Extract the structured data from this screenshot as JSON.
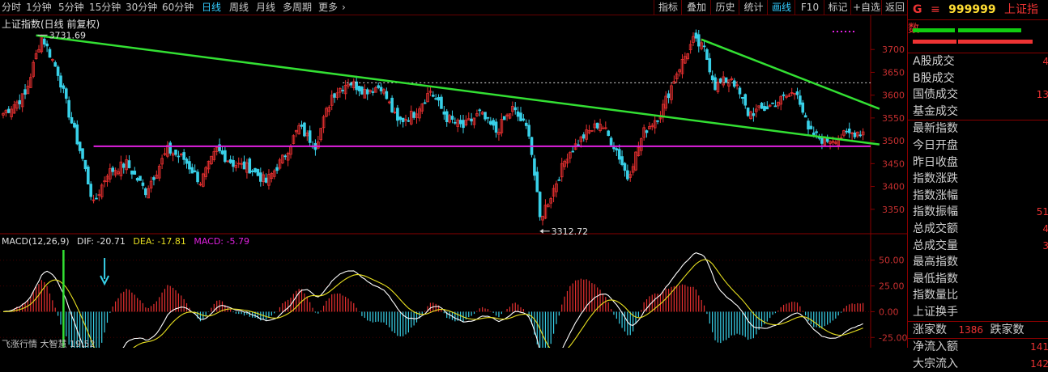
{
  "timeframes": [
    {
      "label": "分时",
      "active": false
    },
    {
      "label": "1分钟",
      "active": false
    },
    {
      "label": "5分钟",
      "active": false
    },
    {
      "label": "15分钟",
      "active": false
    },
    {
      "label": "30分钟",
      "active": false
    },
    {
      "label": "60分钟",
      "active": false
    },
    {
      "label": "日线",
      "active": true
    },
    {
      "label": "周线",
      "active": false
    },
    {
      "label": "月线",
      "active": false
    },
    {
      "label": "多周期",
      "active": false
    },
    {
      "label": "更多",
      "active": false
    }
  ],
  "tools": [
    {
      "label": "指标",
      "active": false
    },
    {
      "label": "叠加",
      "active": false
    },
    {
      "label": "历史",
      "active": false
    },
    {
      "label": "统计",
      "active": false
    },
    {
      "label": "画线",
      "active": true
    },
    {
      "label": "F10",
      "active": false
    },
    {
      "label": "标记",
      "active": false
    },
    {
      "label": "+自选",
      "active": false
    },
    {
      "label": "返回",
      "active": false
    }
  ],
  "chart_title": "上证指数(日线 前复权)",
  "chart_data": {
    "type": "candlestick",
    "y_ticks": [
      3350,
      3400,
      3450,
      3500,
      3550,
      3600,
      3650,
      3700
    ],
    "y_tick_labels": [
      "3350",
      "3400",
      "3450",
      "3500",
      "3550",
      "3600",
      "3650",
      "3700"
    ],
    "ylim": [
      3300,
      3750
    ],
    "high_label": "3731.69",
    "low_label": "3312.72",
    "high_value": 3731.69,
    "low_value": 3312.72,
    "anchors": [
      [
        0,
        3560
      ],
      [
        8,
        3600
      ],
      [
        14,
        3731
      ],
      [
        20,
        3650
      ],
      [
        24,
        3560
      ],
      [
        29,
        3460
      ],
      [
        33,
        3360
      ],
      [
        38,
        3430
      ],
      [
        45,
        3450
      ],
      [
        52,
        3390
      ],
      [
        60,
        3480
      ],
      [
        66,
        3460
      ],
      [
        72,
        3410
      ],
      [
        78,
        3480
      ],
      [
        84,
        3450
      ],
      [
        90,
        3440
      ],
      [
        96,
        3410
      ],
      [
        102,
        3460
      ],
      [
        108,
        3530
      ],
      [
        114,
        3490
      ],
      [
        120,
        3600
      ],
      [
        126,
        3630
      ],
      [
        132,
        3610
      ],
      [
        138,
        3620
      ],
      [
        144,
        3540
      ],
      [
        150,
        3560
      ],
      [
        156,
        3610
      ],
      [
        162,
        3550
      ],
      [
        168,
        3530
      ],
      [
        174,
        3560
      ],
      [
        180,
        3520
      ],
      [
        186,
        3570
      ],
      [
        192,
        3520
      ],
      [
        196,
        3330
      ],
      [
        200,
        3380
      ],
      [
        206,
        3470
      ],
      [
        212,
        3510
      ],
      [
        218,
        3540
      ],
      [
        224,
        3480
      ],
      [
        228,
        3420
      ],
      [
        234,
        3520
      ],
      [
        240,
        3560
      ],
      [
        246,
        3650
      ],
      [
        252,
        3720
      ],
      [
        256,
        3700
      ],
      [
        260,
        3620
      ],
      [
        266,
        3640
      ],
      [
        272,
        3560
      ],
      [
        278,
        3570
      ],
      [
        284,
        3590
      ],
      [
        290,
        3610
      ],
      [
        294,
        3520
      ],
      [
        300,
        3500
      ],
      [
        306,
        3510
      ],
      [
        312,
        3520
      ]
    ],
    "reference_lines": [
      {
        "type": "horizontal",
        "color": "#e020e0",
        "y": 3488,
        "x_from": 33
      },
      {
        "type": "dotted",
        "color": "#e0e0e0",
        "y": 3627,
        "x_from": 124
      },
      {
        "type": "trend",
        "color": "#33e033",
        "from": [
          12,
          3731
        ],
        "to": [
          320,
          3492
        ]
      },
      {
        "type": "trend",
        "color": "#33e033",
        "from": [
          255,
          3722
        ],
        "to": [
          320,
          3570
        ]
      }
    ],
    "macd": {
      "params": "MACD(12,26,9)",
      "dif_label": "DIF: -20.71",
      "dea_label": "DEA: -17.81",
      "macd_label": "MACD: -5.79",
      "y_ticks": [
        50,
        25,
        0,
        -25
      ],
      "y_tick_labels": [
        "50.00",
        "25.00",
        "0.00",
        "-25.00"
      ],
      "ylim": [
        -35,
        60
      ]
    }
  },
  "bottom_left_text": "飞涨行情 大智慧 19.52",
  "right_panel": {
    "code_prefix": "G",
    "menu_icon": "≡",
    "code": "999999",
    "name": "上证指数",
    "rows_a": [
      {
        "label": "A股成交",
        "value": "4"
      },
      {
        "label": "B股成交",
        "value": ""
      },
      {
        "label": "国债成交",
        "value": "13"
      },
      {
        "label": "基金成交",
        "value": ""
      }
    ],
    "rows_b": [
      {
        "label": "最新指数",
        "value": ""
      },
      {
        "label": "今日开盘",
        "value": ""
      },
      {
        "label": "昨日收盘",
        "value": ""
      },
      {
        "label": "指数涨跌",
        "value": ""
      },
      {
        "label": "指数涨幅",
        "value": ""
      },
      {
        "label": "指数振幅",
        "value": "51"
      },
      {
        "label": "总成交额",
        "value": "4"
      },
      {
        "label": "总成交量",
        "value": "3"
      },
      {
        "label": "最高指数",
        "value": ""
      },
      {
        "label": "最低指数",
        "value": ""
      },
      {
        "label": "指数量比",
        "value": ""
      },
      {
        "label": "上证换手",
        "value": ""
      }
    ],
    "up_count_label": "涨家数",
    "up_count": "1386",
    "down_count_label": "跌家数",
    "rows_c": [
      {
        "label": "净流入额",
        "value": "141"
      },
      {
        "label": "大宗流入",
        "value": "142"
      }
    ]
  }
}
